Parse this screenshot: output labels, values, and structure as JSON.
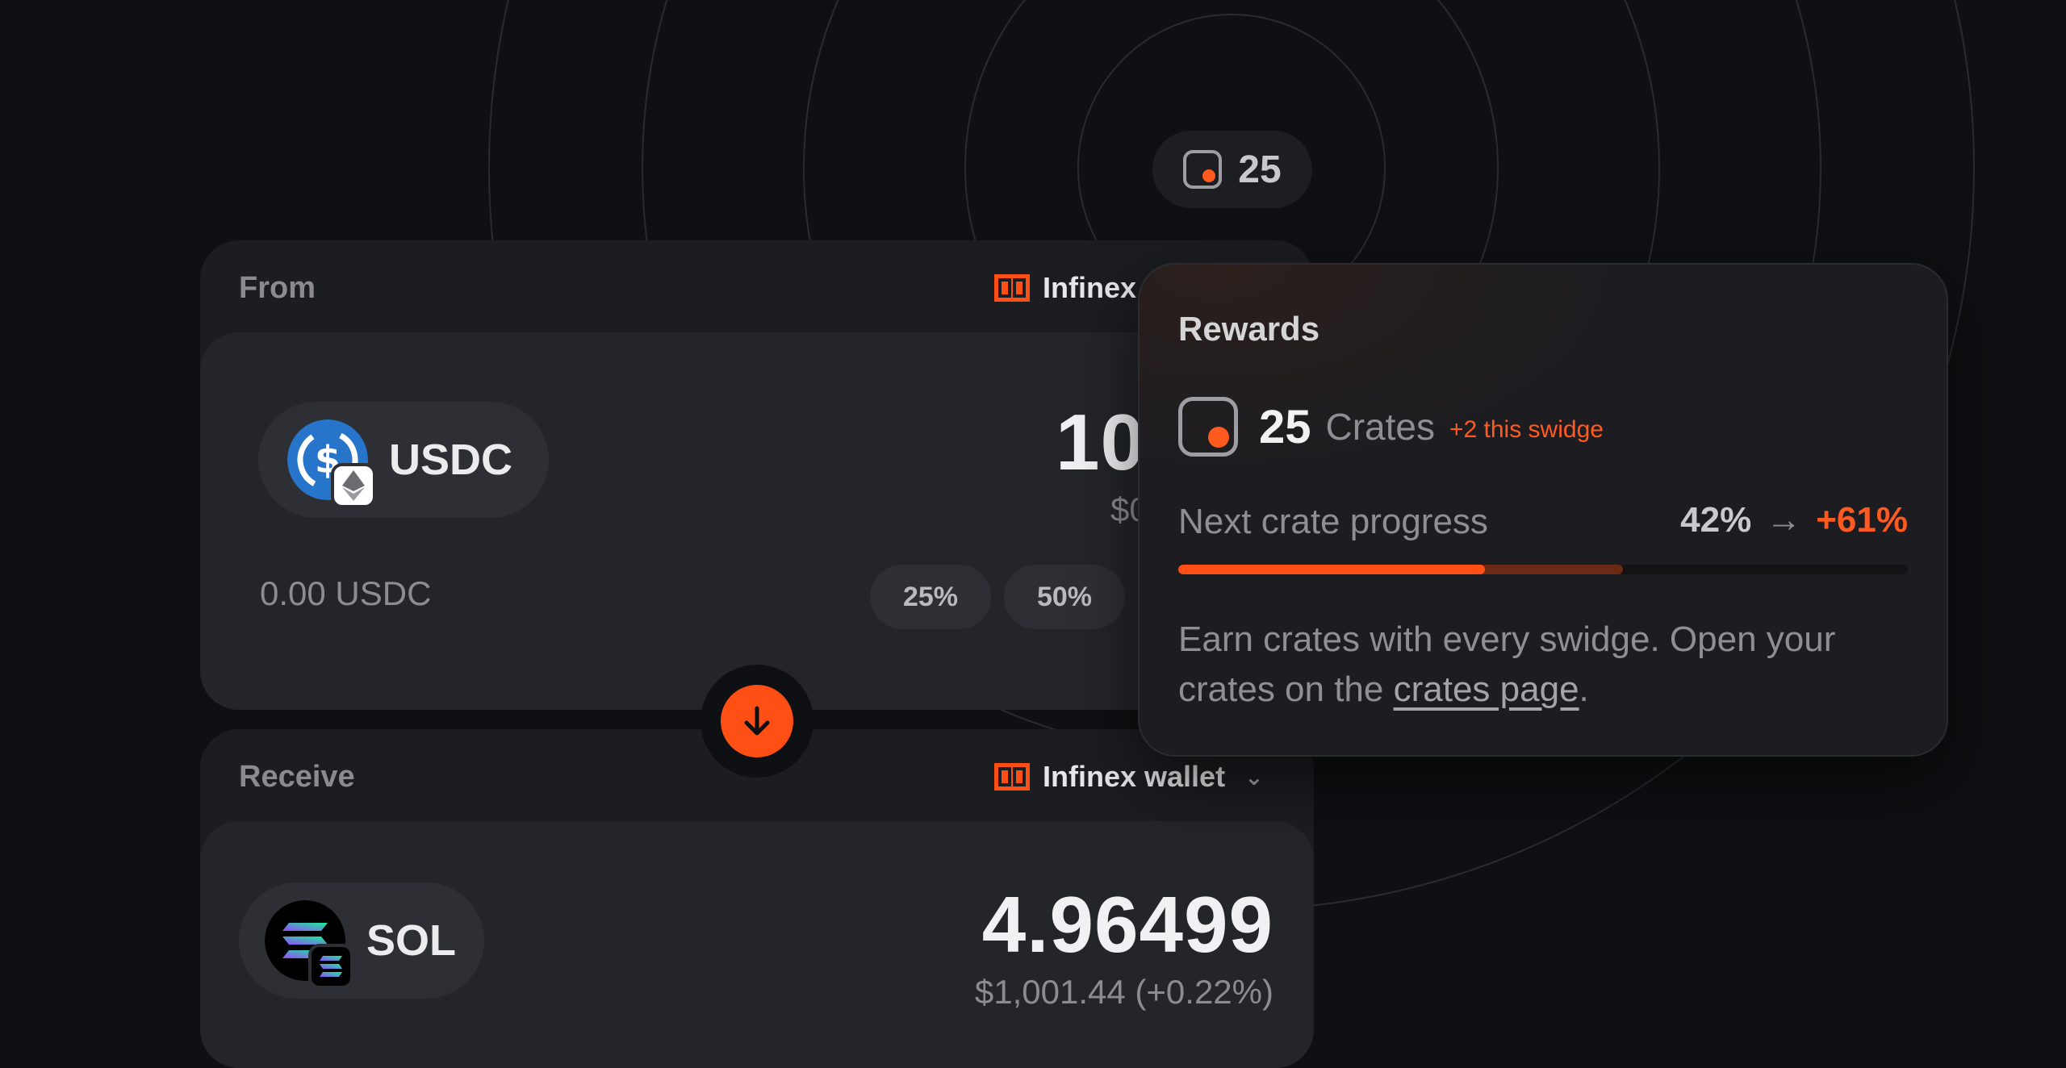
{
  "crate_counter": {
    "count": "25",
    "icon": "crate-icon"
  },
  "from_card": {
    "label": "From",
    "wallet_name": "Infinex",
    "token": {
      "symbol": "USDC",
      "icon": "usdc-icon",
      "network_icon": "ethereum-icon"
    },
    "amount": "10",
    "amount_usd": "$0",
    "balance": "0.00 USDC",
    "percent_buttons": [
      "25%",
      "50%"
    ]
  },
  "swap_button": {
    "icon": "arrow-down-icon"
  },
  "receive_card": {
    "label": "Receive",
    "wallet_name": "Infinex wallet",
    "token": {
      "symbol": "SOL",
      "icon": "solana-icon",
      "network_icon": "solana-network-icon"
    },
    "amount": "4.96499",
    "amount_usd": "$1,001.44 (+0.22%)"
  },
  "rewards": {
    "title": "Rewards",
    "crates_count": "25",
    "crates_label": "Crates",
    "crates_delta": "+2 this swidge",
    "progress_label": "Next crate progress",
    "progress_current": "42%",
    "progress_next": "+61%",
    "progress_current_fraction": 0.42,
    "progress_next_fraction": 0.61,
    "description_text": "Earn crates with every swidge. Open your crates on the ",
    "description_link": "crates page",
    "description_end": "."
  },
  "colors": {
    "accent": "#ff4f14",
    "background": "#0f1013",
    "card": "#1c1d21",
    "panel": "#242529"
  }
}
